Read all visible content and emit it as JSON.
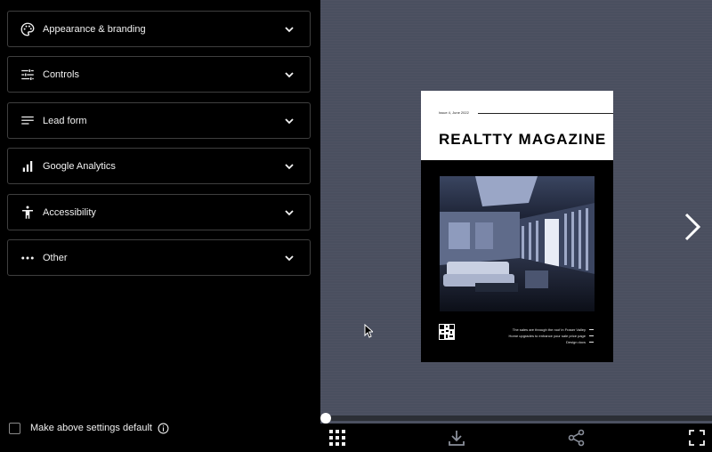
{
  "settings": {
    "sections": [
      {
        "label": "Appearance & branding",
        "icon": "palette-icon"
      },
      {
        "label": "Controls",
        "icon": "sliders-icon"
      },
      {
        "label": "Lead form",
        "icon": "form-lines-icon"
      },
      {
        "label": "Google Analytics",
        "icon": "bar-chart-icon"
      },
      {
        "label": "Accessibility",
        "icon": "accessibility-person-icon"
      },
      {
        "label": "Other",
        "icon": "more-dots-icon"
      }
    ],
    "default_checkbox_label": "Make above settings default",
    "default_checked": false
  },
  "viewer": {
    "cover": {
      "issue": "Issue 4, June 2022",
      "title": "REALTTY MAGAZINE",
      "lines": [
        "The sales are through the roof in Fraser Valley",
        "Home upgrades to enhance your sale price page",
        "Design docs"
      ]
    },
    "progress": 0,
    "toolbar": {
      "grid": "grid-view-icon",
      "download": "download-icon",
      "share": "share-icon",
      "fullscreen": "fullscreen-icon"
    }
  },
  "colors": {
    "panel_bg": "#000000",
    "viewer_bg": "#4a4f5f",
    "border": "#3f3f3f",
    "text": "#f2f2f2"
  }
}
